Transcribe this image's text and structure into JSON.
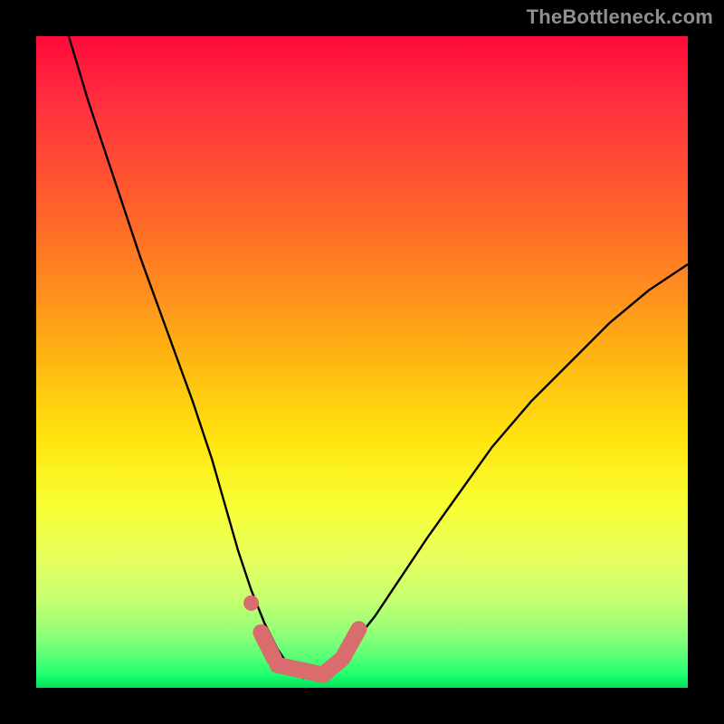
{
  "watermark": {
    "text": "TheBottleneck.com"
  },
  "colors": {
    "curve": "#000000",
    "marker": "#d96c6c",
    "marker_stroke": "#d96c6c",
    "frame": "#000000"
  },
  "chart_data": {
    "type": "line",
    "title": "",
    "xlabel": "",
    "ylabel": "",
    "xlim": [
      0,
      100
    ],
    "ylim": [
      0,
      100
    ],
    "grid": false,
    "legend": false,
    "description": "Bottleneck percentage curve (V-shape). x = relative hardware balance, y = bottleneck %",
    "series": [
      {
        "name": "bottleneck_curve",
        "x": [
          5,
          8,
          12,
          16,
          20,
          24,
          27,
          29,
          31,
          33,
          35,
          37,
          39,
          41,
          43,
          45,
          48,
          52,
          56,
          60,
          65,
          70,
          76,
          82,
          88,
          94,
          100
        ],
        "y": [
          100,
          90,
          78,
          66,
          55,
          44,
          35,
          28,
          21,
          15,
          10,
          6,
          3,
          1.5,
          1.5,
          3,
          6,
          11,
          17,
          23,
          30,
          37,
          44,
          50,
          56,
          61,
          65
        ]
      }
    ],
    "optimal_markers": {
      "comment": "Pink overlay near curve minimum",
      "dot": {
        "x": 33,
        "y": 13
      },
      "segments": [
        {
          "from": {
            "x": 34.5,
            "y": 8.5
          },
          "to": {
            "x": 36.5,
            "y": 4.5
          }
        },
        {
          "from": {
            "x": 37,
            "y": 3.5
          },
          "to": {
            "x": 44,
            "y": 2.0
          }
        },
        {
          "from": {
            "x": 44,
            "y": 2.0
          },
          "to": {
            "x": 47,
            "y": 4.5
          }
        },
        {
          "from": {
            "x": 47,
            "y": 4.5
          },
          "to": {
            "x": 49.5,
            "y": 9.0
          }
        }
      ]
    }
  }
}
